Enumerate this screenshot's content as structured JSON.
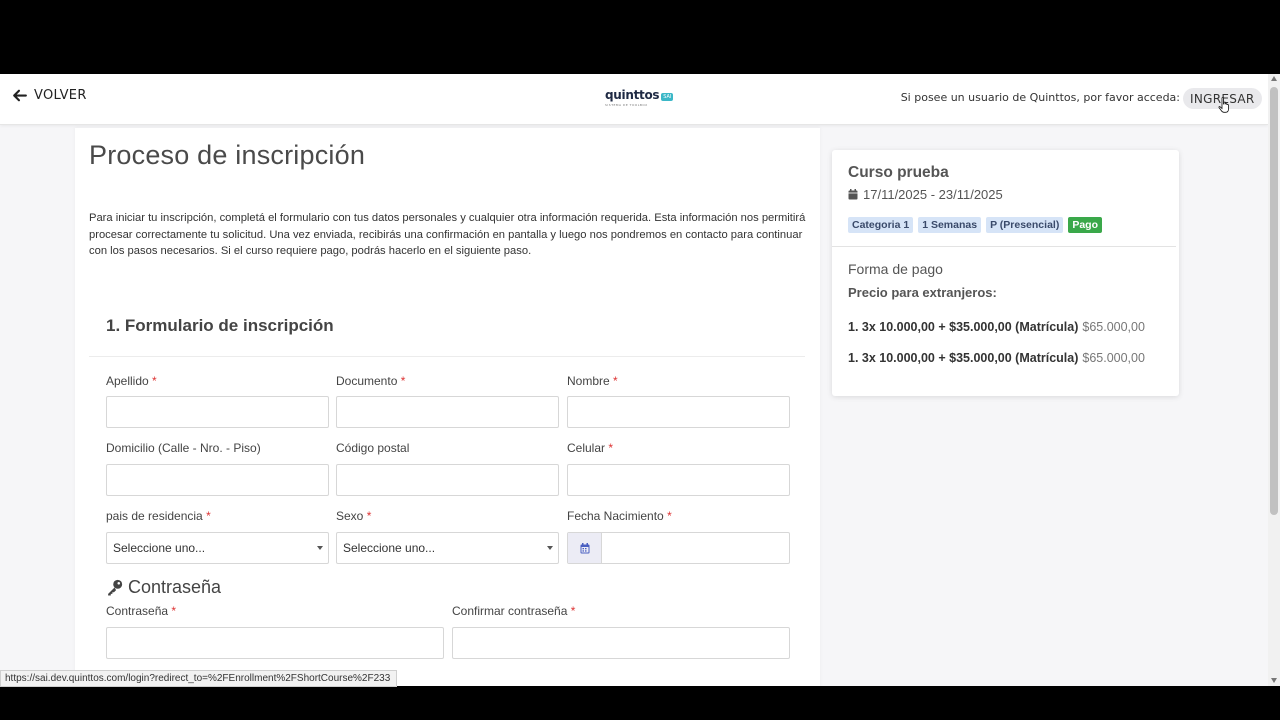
{
  "header": {
    "back_label": "VOLVER",
    "logo_name": "quinttos",
    "logo_tag": "SAI",
    "logo_sub": "SISTEMA DE TOOLBOX",
    "login_prompt": "Si posee un usuario de Quinttos, por favor acceda:",
    "login_button": "INGRESAR"
  },
  "main": {
    "title": "Proceso de inscripción",
    "intro": "Para iniciar tu inscripción, completá el formulario con tus datos personales y cualquier otra información requerida. Esta información nos permitirá procesar correctamente tu solicitud. Una vez enviada, recibirás una confirmación en pantalla y luego nos pondremos en contacto para continuar con los pasos necesarios. Si el curso requiere pago, podrás hacerlo en el siguiente paso.",
    "section_title": "1. Formulario de inscripción",
    "fields": {
      "apellido": {
        "label": "Apellido",
        "value": ""
      },
      "documento": {
        "label": "Documento",
        "value": ""
      },
      "nombre": {
        "label": "Nombre",
        "value": ""
      },
      "domicilio": {
        "label": "Domicilio (Calle - Nro. - Piso)",
        "value": ""
      },
      "codigo_postal": {
        "label": "Código postal",
        "value": ""
      },
      "celular": {
        "label": "Celular",
        "value": ""
      },
      "pais": {
        "label": "pais de residencia",
        "value": "Seleccione uno..."
      },
      "sexo": {
        "label": "Sexo",
        "value": "Seleccione uno..."
      },
      "fecha_nacimiento": {
        "label": "Fecha Nacimiento",
        "value": ""
      }
    },
    "password_section": "Contraseña",
    "password_fields": {
      "password": {
        "label": "Contraseña",
        "value": ""
      },
      "confirm": {
        "label": "Confirmar contraseña",
        "value": ""
      }
    },
    "required_mark": "*"
  },
  "course": {
    "title": "Curso prueba",
    "dates": "17/11/2025 - 23/11/2025",
    "badges": [
      "Categoria 1",
      "1 Semanas",
      "P (Presencial)",
      "Pago"
    ],
    "payment_title": "Forma de pago",
    "payment_subtitle": "Precio para extranjeros:",
    "prices": [
      {
        "plan": "1. 3x 10.000,00 + $35.000,00 (Matrícula)",
        "total": "$65.000,00"
      },
      {
        "plan": "1. 3x 10.000,00 + $35.000,00 (Matrícula)",
        "total": "$65.000,00"
      }
    ]
  },
  "status_url": "https://sai.dev.quinttos.com/login?redirect_to=%2FEnrollment%2FShortCourse%2F233",
  "colors": {
    "badge_info": "#d6e4f7",
    "badge_ok": "#3aa84a",
    "required": "#dd3333",
    "date_button": "#ececf5"
  }
}
